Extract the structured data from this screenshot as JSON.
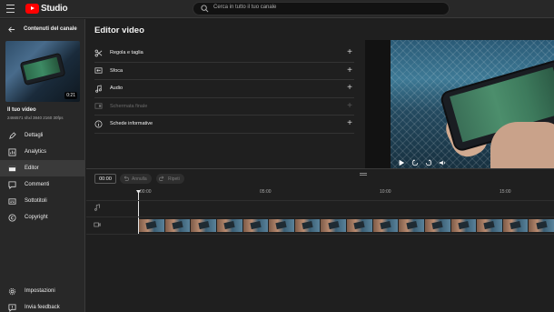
{
  "app": {
    "name": "Studio"
  },
  "search": {
    "placeholder": "Cerca in tutto il tuo canale"
  },
  "sidebar": {
    "title": "Contenuti del canale",
    "video": {
      "duration": "0:21",
      "title": "Il tuo video",
      "subtitle": "2466571 shxl 3840 2160 30fps"
    },
    "items": [
      {
        "label": "Dettagli",
        "icon": "pencil-icon",
        "active": false
      },
      {
        "label": "Analytics",
        "icon": "analytics-icon",
        "active": false
      },
      {
        "label": "Editor",
        "icon": "editor-icon",
        "active": true
      },
      {
        "label": "Commenti",
        "icon": "comment-icon",
        "active": false
      },
      {
        "label": "Sottotitoli",
        "icon": "subtitles-icon",
        "active": false
      },
      {
        "label": "Copyright",
        "icon": "copyright-icon",
        "active": false
      }
    ],
    "bottom": [
      {
        "label": "Impostazioni",
        "icon": "gear-icon"
      },
      {
        "label": "Invia feedback",
        "icon": "feedback-icon"
      }
    ]
  },
  "editor": {
    "title": "Editor video",
    "tools": [
      {
        "label": "Regola e taglia",
        "icon": "scissors-icon",
        "enabled": true
      },
      {
        "label": "Sfoca",
        "icon": "blur-icon",
        "enabled": true
      },
      {
        "label": "Audio",
        "icon": "music-note-icon",
        "enabled": true
      },
      {
        "label": "Schermata finale",
        "icon": "end-screen-icon",
        "enabled": false
      },
      {
        "label": "Schede informative",
        "icon": "info-icon",
        "enabled": true
      }
    ]
  },
  "timeline": {
    "current_time": "00:00",
    "undo_label": "Annulla",
    "redo_label": "Ripeti",
    "ruler_labels": [
      "00:00",
      "05:00",
      "10:00",
      "15:00"
    ]
  },
  "colors": {
    "brand_red": "#ff0000",
    "active_bg": "#3a3a3a"
  }
}
